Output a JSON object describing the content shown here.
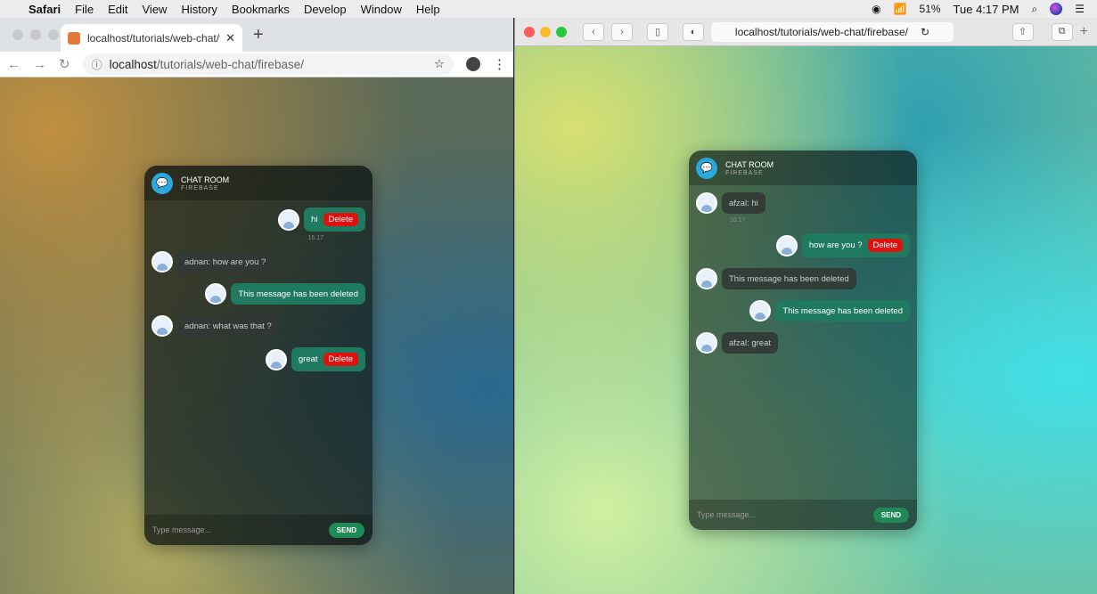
{
  "menubar": {
    "app": "Safari",
    "items": [
      "File",
      "Edit",
      "View",
      "History",
      "Bookmarks",
      "Develop",
      "Window",
      "Help"
    ],
    "battery": "51%",
    "clock": "Tue 4:17 PM"
  },
  "chrome": {
    "tab_title": "localhost/tutorials/web-chat/fir",
    "url_host": "localhost",
    "url_path": "/tutorials/web-chat/firebase/"
  },
  "safari": {
    "url": "localhost/tutorials/web-chat/firebase/"
  },
  "chat": {
    "title": "CHAT ROOM",
    "subtitle": "FIREBASE",
    "placeholder": "Type message...",
    "send": "SEND",
    "delete": "Delete"
  },
  "left_messages": [
    {
      "side": "sent",
      "text": "hi",
      "delete": true,
      "time": "16:17"
    },
    {
      "side": "recv",
      "text": "adnan: how are you ?"
    },
    {
      "side": "sent",
      "text": "This message has been deleted"
    },
    {
      "side": "recv",
      "text": "adnan: what was that ?"
    },
    {
      "side": "sent",
      "text": "great",
      "delete": true
    }
  ],
  "right_messages": [
    {
      "side": "recv",
      "text": "afzal: hi",
      "time": "16:17"
    },
    {
      "side": "sent",
      "text": "how are you ?",
      "delete": true
    },
    {
      "side": "recv",
      "text": "This message has been deleted"
    },
    {
      "side": "sent",
      "text": "This message has been deleted"
    },
    {
      "side": "recv",
      "text": "afzal: great"
    }
  ]
}
